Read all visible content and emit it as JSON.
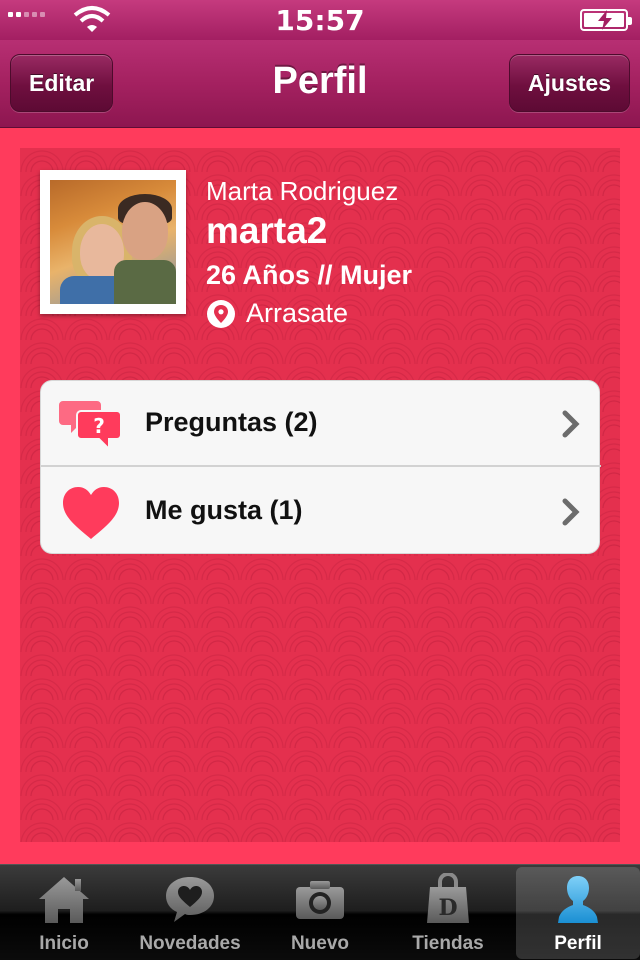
{
  "status_bar": {
    "time": "15:57",
    "signal_icon": "signal-bars-icon",
    "wifi_icon": "wifi-icon",
    "battery_icon": "battery-charging-icon"
  },
  "nav": {
    "title": "Perfil",
    "left_button": "Editar",
    "right_button": "Ajustes"
  },
  "profile": {
    "full_name": "Marta Rodriguez",
    "username": "marta2",
    "age_gender": "26 Años // Mujer",
    "location": "Arrasate",
    "photo_icon": "profile-photo"
  },
  "menu": [
    {
      "label": "Preguntas (2)",
      "icon": "questions-icon"
    },
    {
      "label": "Me gusta (1)",
      "icon": "heart-icon"
    }
  ],
  "tabs": [
    {
      "label": "Inicio",
      "icon": "home-icon"
    },
    {
      "label": "Novedades",
      "icon": "heart-bubble-icon"
    },
    {
      "label": "Nuevo",
      "icon": "camera-icon"
    },
    {
      "label": "Tiendas",
      "icon": "shopping-bag-icon"
    },
    {
      "label": "Perfil",
      "icon": "person-icon",
      "active": true
    }
  ],
  "colors": {
    "accent": "#ff3b5c",
    "navbar": "#a42160",
    "card": "#e4304e",
    "heart": "#ff3b5c",
    "active_tab_icon": "#37a9e6"
  }
}
